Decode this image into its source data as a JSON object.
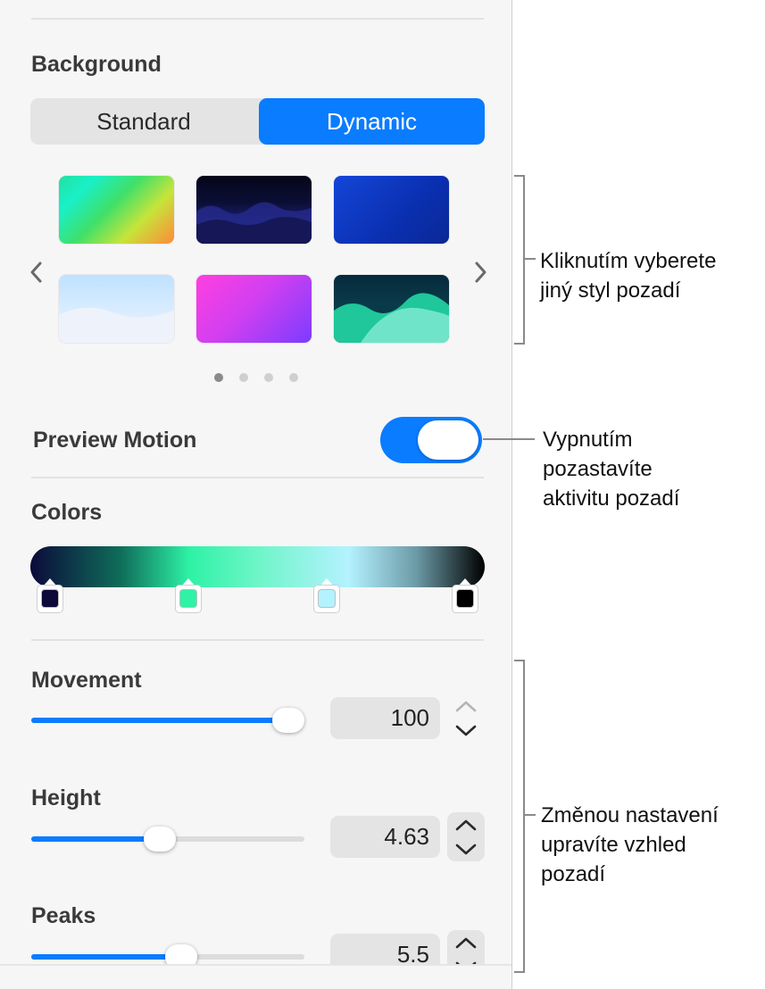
{
  "background": {
    "title": "Background",
    "segments": [
      {
        "label": "Standard",
        "active": false
      },
      {
        "label": "Dynamic",
        "active": true
      }
    ],
    "thumbnails": [
      "gradient-rainbow",
      "dark-waves",
      "blue-gradient",
      "light-clouds",
      "pink-purple",
      "teal-hills"
    ],
    "pager": {
      "page": 1,
      "count": 4
    }
  },
  "preview_motion": {
    "label": "Preview Motion",
    "enabled": true
  },
  "colors": {
    "title": "Colors",
    "stops": [
      "#0d0a3a",
      "#2ef2a6",
      "#b4f2ff",
      "#000000"
    ]
  },
  "movement": {
    "label": "Movement",
    "value": "100",
    "fraction": 1.0
  },
  "height": {
    "label": "Height",
    "value": "4.63",
    "fraction": 0.47
  },
  "peaks": {
    "label": "Peaks",
    "value": "5.5",
    "fraction": 0.55
  },
  "callouts": {
    "styles": "Kliknutím vyberete\njiný styl pozadí",
    "motion": "Vypnutím\npozastavíte\naktivitu pozadí",
    "settings": "Změnou nastavení\nupravíte vzhled\npozadí"
  },
  "accent_color": "#0a7cff"
}
